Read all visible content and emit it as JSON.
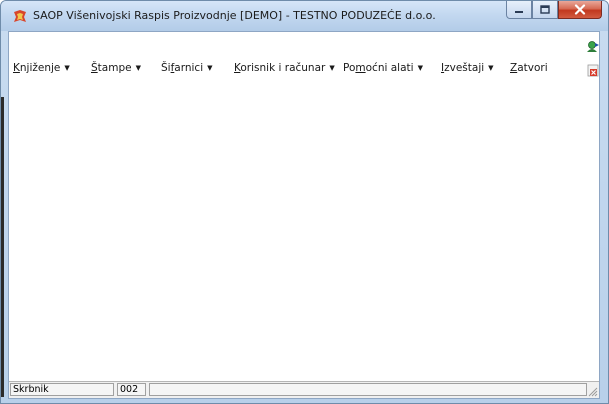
{
  "window": {
    "title": "SAOP   Višenivojski Raspis Proizvodnje [DEMO] - TESTNO PODUZEĆE d.o.o.",
    "icon": "app-logo-icon"
  },
  "menu": [
    {
      "pre": "",
      "u": "K",
      "post": "njiženje",
      "dropdown": true
    },
    {
      "pre": "",
      "u": "Š",
      "post": "tampe",
      "dropdown": true
    },
    {
      "pre": "Ši",
      "u": "f",
      "post": "arnici",
      "dropdown": true
    },
    {
      "pre": "",
      "u": "K",
      "post": "orisnik i računar",
      "dropdown": true
    },
    {
      "pre": "Po",
      "u": "m",
      "post": "oćni alati",
      "dropdown": true
    },
    {
      "pre": "",
      "u": "I",
      "post": "zveštaji",
      "dropdown": true
    },
    {
      "pre": "",
      "u": "Z",
      "post": "atvori",
      "dropdown": false
    }
  ],
  "toolbar_icons": [
    "user-switch-icon",
    "exit-icon"
  ],
  "statusbar": {
    "user": "Skrbnik",
    "code": "002",
    "message": ""
  },
  "colors": {
    "titlebar": "#c3d8f0",
    "close_button": "#c2381f",
    "background": "#ffffff"
  }
}
